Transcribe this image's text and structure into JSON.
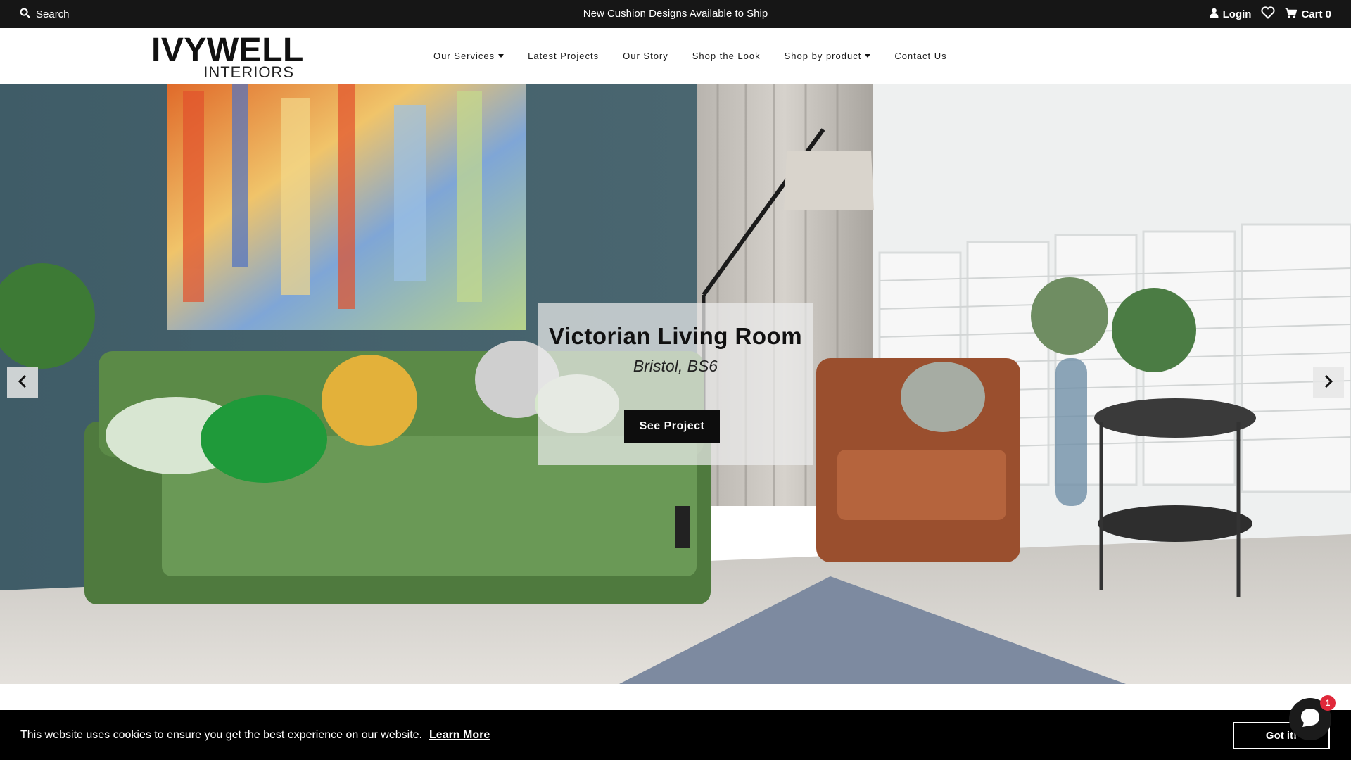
{
  "topbar": {
    "search_label": "Search",
    "announcement": "New Cushion Designs Available to Ship",
    "login_label": "Login",
    "cart_label": "Cart 0"
  },
  "logo": {
    "line1": "IVYWELL",
    "line2": "INTERIORS"
  },
  "nav": {
    "items": [
      {
        "label": "Our Services",
        "has_dropdown": true
      },
      {
        "label": "Latest Projects",
        "has_dropdown": false
      },
      {
        "label": "Our Story",
        "has_dropdown": false
      },
      {
        "label": "Shop the Look",
        "has_dropdown": false
      },
      {
        "label": "Shop by product",
        "has_dropdown": true
      },
      {
        "label": "Contact Us",
        "has_dropdown": false
      }
    ]
  },
  "hero": {
    "title": "Victorian Living Room",
    "subtitle": "Bristol, BS6",
    "button_label": "See Project",
    "prev_icon": "chevron-left-icon",
    "next_icon": "chevron-right-icon"
  },
  "cookie": {
    "message": "This website uses cookies to ensure you get the best experience on our website.",
    "learn_more": "Learn More",
    "accept_label": "Got it!"
  },
  "chat": {
    "badge_count": "1"
  },
  "colors": {
    "topbar_bg": "#161616",
    "wall": "#3e5a66",
    "sofa": "#4f7a3e",
    "armchair": "#9a4f2e",
    "cookie_bg": "#000000",
    "badge": "#e0283a"
  }
}
